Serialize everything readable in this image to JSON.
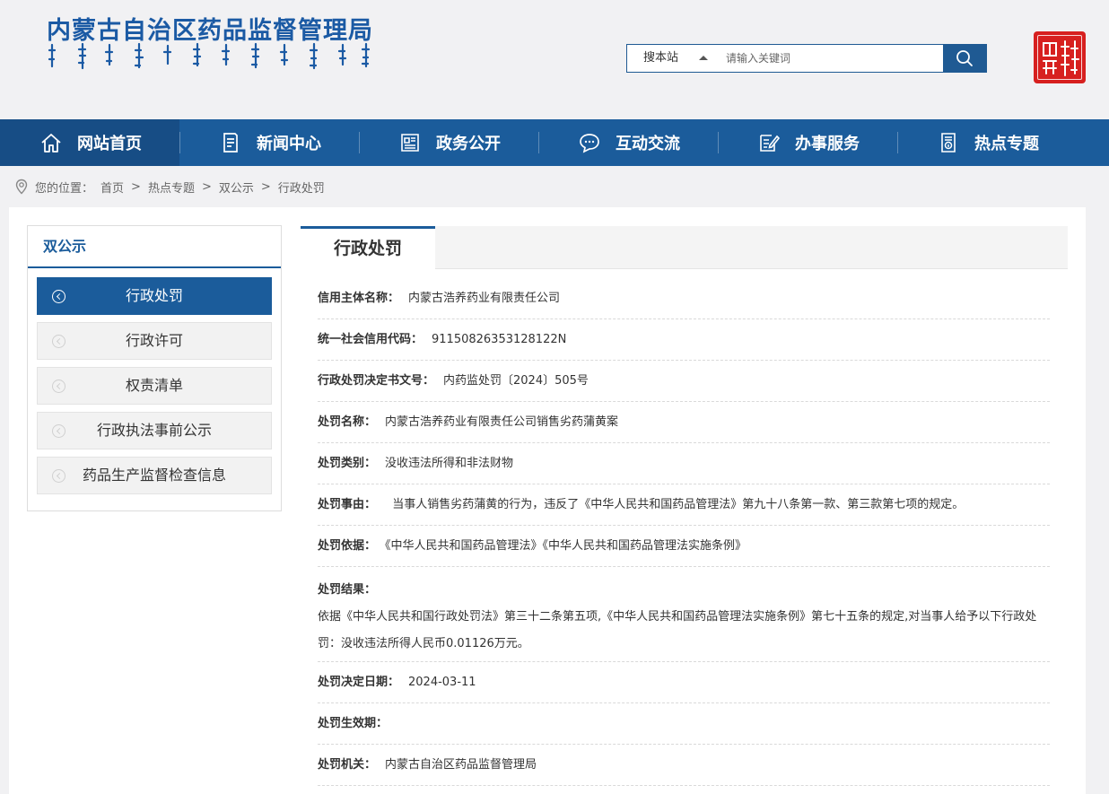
{
  "header": {
    "site_title": "内蒙古自治区药品监督管理局",
    "mongolian_logo": "mongolian-script-title",
    "seal": "nmg-seal-logo",
    "search": {
      "scope_label": "搜本站",
      "placeholder": "请输入关键词",
      "button_icon": "search-icon"
    }
  },
  "nav": {
    "items": [
      {
        "label": "网站首页",
        "icon": "home-icon"
      },
      {
        "label": "新闻中心",
        "icon": "document-icon"
      },
      {
        "label": "政务公开",
        "icon": "newspaper-icon"
      },
      {
        "label": "互动交流",
        "icon": "chat-icon"
      },
      {
        "label": "办事服务",
        "icon": "edit-icon"
      },
      {
        "label": "热点专题",
        "icon": "info-doc-icon"
      }
    ],
    "active_index": 0
  },
  "breadcrumb": {
    "prefix": "您的位置：",
    "items": [
      "首页",
      "热点专题",
      "双公示",
      "行政处罚"
    ],
    "separator": ">"
  },
  "sidebar": {
    "title": "双公示",
    "items": [
      "行政处罚",
      "行政许可",
      "权责清单",
      "行政执法事前公示",
      "药品生产监督检查信息"
    ],
    "active_index": 0
  },
  "content": {
    "tab_label": "行政处罚",
    "fields": [
      {
        "label": "信用主体名称：",
        "value": "内蒙古浩养药业有限责任公司"
      },
      {
        "label": "统一社会信用代码：",
        "value": "91150826353128122N"
      },
      {
        "label": "行政处罚决定书文号：",
        "value": "内药监处罚〔2024〕505号"
      },
      {
        "label": "处罚名称：",
        "value": "内蒙古浩养药业有限责任公司销售劣药蒲黄案"
      },
      {
        "label": "处罚类别：",
        "value": "没收违法所得和非法财物"
      },
      {
        "label": "处罚事由：",
        "value": "  当事人销售劣药蒲黄的行为，违反了《中华人民共和国药品管理法》第九十八条第一款、第三款第七项的规定。"
      },
      {
        "label": "处罚依据：",
        "value": "《中华人民共和国药品管理法》《中华人民共和国药品管理法实施条例》"
      }
    ],
    "result": {
      "label": "处罚结果：",
      "value": "依据《中华人民共和国行政处罚法》第三十二条第五项,《中华人民共和国药品管理法实施条例》第七十五条的规定,对当事人给予以下行政处罚：没收违法所得人民币0.01126万元。"
    },
    "fields_after": [
      {
        "label": "处罚决定日期：",
        "value": "2024-03-11"
      },
      {
        "label": "处罚生效期：",
        "value": ""
      },
      {
        "label": "处罚机关：",
        "value": "内蒙古自治区药品监督管理局"
      }
    ]
  },
  "colors": {
    "brand_blue": "#1b5c9b",
    "nav_active": "#174d85",
    "title_blue": "#1b5aa4",
    "seal_red": "#d7201f"
  }
}
